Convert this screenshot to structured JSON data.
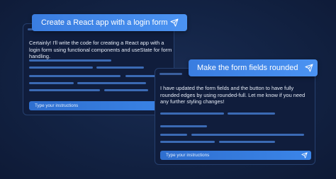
{
  "colors": {
    "background": "#132446",
    "panel": "#101d3c",
    "accent": "#3b85e8",
    "placeholder_line": "#3b6ab4"
  },
  "panel1": {
    "prompt": "Create a React app with a login form",
    "response": "Certainly! I'll write the code for creating a React app with a login form using functional components and useState for form handling.",
    "input_placeholder": "Type your instructions",
    "send_icon": "send-icon"
  },
  "panel2": {
    "prompt": "Make the form fields rounded",
    "response": "I have updated the form fields and the button to have fully rounded edges by using rounded-full. Let me know if you need any further styling changes!",
    "input_placeholder": "Type your instructions",
    "send_icon": "send-icon"
  }
}
